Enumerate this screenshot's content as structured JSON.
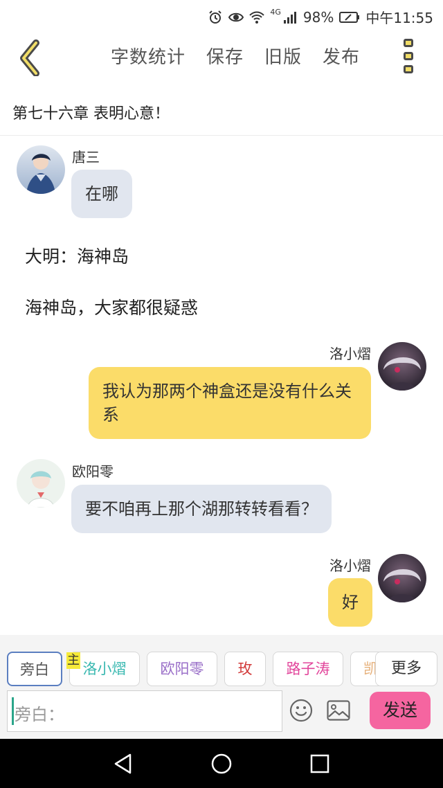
{
  "status_bar": {
    "network": "4G",
    "battery": "98%",
    "time": "中午11:55",
    "icons": [
      "alarm-icon",
      "eye-icon",
      "wifi-icon",
      "signal-icon",
      "battery-icon"
    ]
  },
  "nav": {
    "back_icon": "chevron-left-icon",
    "actions": [
      "字数统计",
      "保存",
      "旧版",
      "发布"
    ],
    "more_icon": "more-vertical-icon"
  },
  "chapter": {
    "title": "第七十六章 表明心意！"
  },
  "messages": [
    {
      "side": "left",
      "sender": "唐三",
      "text": "在哪"
    },
    {
      "side": "narration",
      "text": "大明：海神岛"
    },
    {
      "side": "narration",
      "text": "海神岛，大家都很疑惑"
    },
    {
      "side": "right",
      "sender": "洛小熠",
      "text": "我认为那两个神盒还是没有什么关系"
    },
    {
      "side": "left",
      "sender": "欧阳零",
      "text": "要不咱再上那个湖那转转看看？"
    },
    {
      "side": "right",
      "sender": "洛小熠",
      "text": "好"
    }
  ],
  "composer": {
    "roles": [
      {
        "label": "旁白",
        "color": "#555555"
      },
      {
        "label": "洛小熠",
        "color": "#38b8b0"
      },
      {
        "label": "欧阳零",
        "color": "#9a6fc8"
      },
      {
        "label": "玫",
        "color": "#d23a3a"
      },
      {
        "label": "路子涛",
        "color": "#e2459b"
      },
      {
        "label": "凯",
        "color": "#e6b07a"
      }
    ],
    "main_tag": "主",
    "more_label": "更多",
    "input_placeholder": "旁白：",
    "emoji_icon": "emoji-icon",
    "image_icon": "image-icon",
    "send_label": "发送"
  },
  "system_nav": [
    "back-triangle-icon",
    "home-circle-icon",
    "recents-square-icon"
  ],
  "colors": {
    "accent_yellow": "#fbdc69",
    "bubble_gray": "#e1e6ef",
    "send_pink": "#f565a0"
  }
}
